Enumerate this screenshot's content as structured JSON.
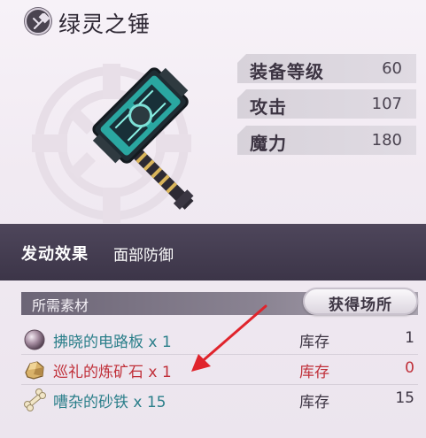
{
  "item": {
    "title": "绿灵之锤",
    "icon": "hammer-icon"
  },
  "stats": [
    {
      "label": "装备等级",
      "value": "60"
    },
    {
      "label": "攻击",
      "value": "107"
    },
    {
      "label": "魔力",
      "value": "180"
    }
  ],
  "effect": {
    "label": "发动效果",
    "value": "面部防御"
  },
  "materials": {
    "header": "所需素材",
    "get_button": "获得场所",
    "rows": [
      {
        "name": "拂晓的电路板 x 1",
        "stock_label": "库存",
        "stock_value": "1",
        "icon": "orb-icon",
        "status": "sufficient"
      },
      {
        "name": "巡礼的炼矿石 x 1",
        "stock_label": "库存",
        "stock_value": "0",
        "icon": "ore-icon",
        "status": "insufficient"
      },
      {
        "name": "嘈杂的砂铁 x 15",
        "stock_label": "库存",
        "stock_value": "15",
        "icon": "bone-icon",
        "status": "sufficient"
      }
    ]
  },
  "colors": {
    "sufficient_text": "#2b7f8a",
    "insufficient_text": "#c0303a",
    "effect_band": "#433b4f",
    "annotation_arrow": "#e0242c"
  }
}
